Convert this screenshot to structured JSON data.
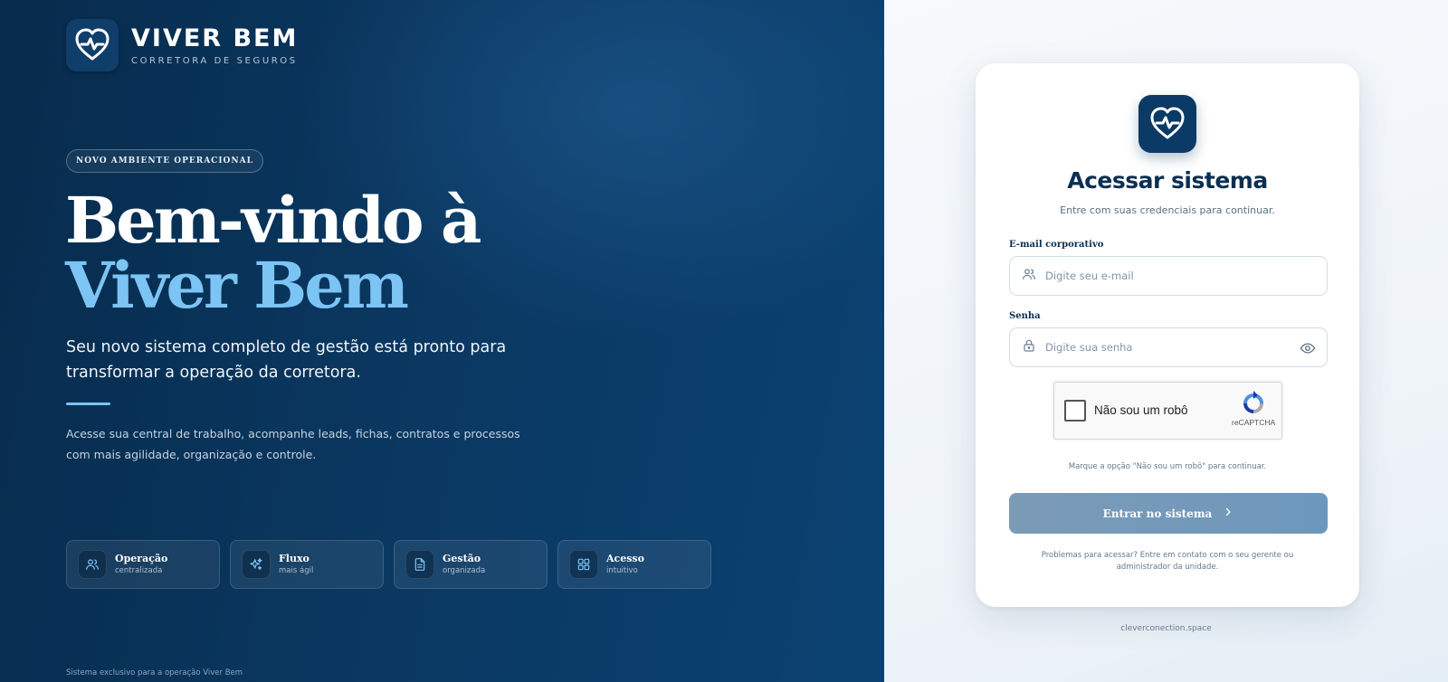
{
  "brand": {
    "name": "VIVER BEM",
    "tagline": "CORRETORA DE SEGUROS"
  },
  "hero": {
    "badge": "NOVO AMBIENTE OPERACIONAL",
    "title_line1": "Bem-vindo à",
    "title_line2": "Viver Bem",
    "subtitle": "Seu novo sistema completo de gestão está pronto para transformar a operação da corretora.",
    "description": "Acesse sua central de trabalho, acompanhe leads, fichas, contratos e processos com mais agilidade, organização e controle."
  },
  "features": [
    {
      "title": "Operação",
      "subtitle": "centralizada",
      "icon": "users-icon"
    },
    {
      "title": "Fluxo",
      "subtitle": "mais ágil",
      "icon": "sparkles-icon"
    },
    {
      "title": "Gestão",
      "subtitle": "organizada",
      "icon": "document-icon"
    },
    {
      "title": "Acesso",
      "subtitle": "intuitivo",
      "icon": "grid-icon"
    }
  ],
  "footer_left": "Sistema exclusivo para a operação Viver Bem",
  "login": {
    "title": "Acessar sistema",
    "subtitle": "Entre com suas credenciais para continuar.",
    "email_label": "E-mail corporativo",
    "email_placeholder": "Digite seu e-mail",
    "password_label": "Senha",
    "password_placeholder": "Digite sua senha",
    "captcha_label": "Não sou um robô",
    "captcha_brand": "reCAPTCHA",
    "captcha_hint": "Marque a opção \"Não sou um robô\" para continuar.",
    "submit_label": "Entrar no sistema",
    "help_text": "Problemas para acessar? Entre em contato com o seu gerente ou administrador da unidade."
  },
  "domain": "cleverconection.space",
  "colors": {
    "primary_dark": "#0b3a66",
    "accent_light": "#7cc4f3",
    "button": "#6d97bc"
  }
}
